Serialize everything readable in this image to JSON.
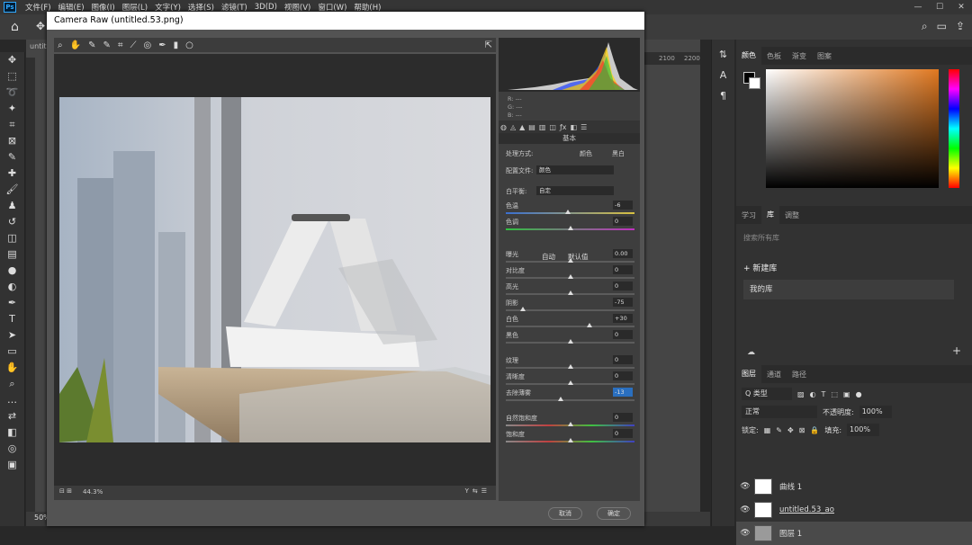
{
  "menubar": {
    "logo": "Ps",
    "items": [
      "文件(F)",
      "编辑(E)",
      "图像(I)",
      "图层(L)",
      "文字(Y)",
      "选择(S)",
      "滤镜(T)",
      "3D(D)",
      "视图(V)",
      "窗口(W)",
      "帮助(H)"
    ],
    "window_controls": [
      "—",
      "☐",
      "✕"
    ]
  },
  "document": {
    "tab": "untitle",
    "zoom": "50%",
    "ruler_ticks": [
      "2100",
      "2200"
    ]
  },
  "camera_raw": {
    "title": "Camera Raw (untitled.53.png)",
    "zoom": "44.3%",
    "readout": [
      "R: ---",
      "G: ---",
      "B: ---"
    ],
    "section": "基本",
    "treatment_label": "处理方式:",
    "treatment_color": "颜色",
    "treatment_bw": "黑白",
    "profile_label": "配置文件:",
    "profile_value": "颜色",
    "wb_label": "白平衡:",
    "wb_value": "自定",
    "auto": "自动",
    "default": "默认值",
    "sliders": [
      {
        "label": "色温",
        "value": "-6",
        "pos": 0.48
      },
      {
        "label": "色调",
        "value": "0",
        "pos": 0.5
      },
      {
        "label": "曝光",
        "value": "0.00",
        "pos": 0.5
      },
      {
        "label": "对比度",
        "value": "0",
        "pos": 0.5
      },
      {
        "label": "高光",
        "value": "0",
        "pos": 0.5
      },
      {
        "label": "阴影",
        "value": "-75",
        "pos": 0.13
      },
      {
        "label": "白色",
        "value": "+30",
        "pos": 0.65
      },
      {
        "label": "黑色",
        "value": "0",
        "pos": 0.5
      },
      {
        "label": "纹理",
        "value": "0",
        "pos": 0.5
      },
      {
        "label": "清晰度",
        "value": "0",
        "pos": 0.5
      },
      {
        "label": "去除薄雾",
        "value": "-13",
        "pos": 0.43
      },
      {
        "label": "自然饱和度",
        "value": "0",
        "pos": 0.5
      },
      {
        "label": "饱和度",
        "value": "0",
        "pos": 0.5
      }
    ],
    "cancel": "取消",
    "ok": "确定"
  },
  "right_panel": {
    "color_tabs": [
      "颜色",
      "色板",
      "渐变",
      "图案"
    ],
    "lib_tabs": [
      "学习",
      "库",
      "调整"
    ],
    "lib_search_placeholder": "搜索所有库",
    "new_lib": "+ 新建库",
    "my_lib": "我的库",
    "layer_tabs": [
      "图层",
      "通道",
      "路径"
    ],
    "kind": "Q 类型",
    "blend": "正常",
    "opacity_label": "不透明度:",
    "opacity": "100%",
    "lock_label": "锁定:",
    "fill_label": "填充:",
    "fill": "100%",
    "layers": [
      {
        "name": "曲线 1",
        "selected": false
      },
      {
        "name": "untitled.53_ao",
        "selected": false
      },
      {
        "name": "图层 1",
        "selected": true
      }
    ]
  },
  "colors": {
    "accent": "#2a6fbf",
    "hue_start": "#e07820"
  }
}
